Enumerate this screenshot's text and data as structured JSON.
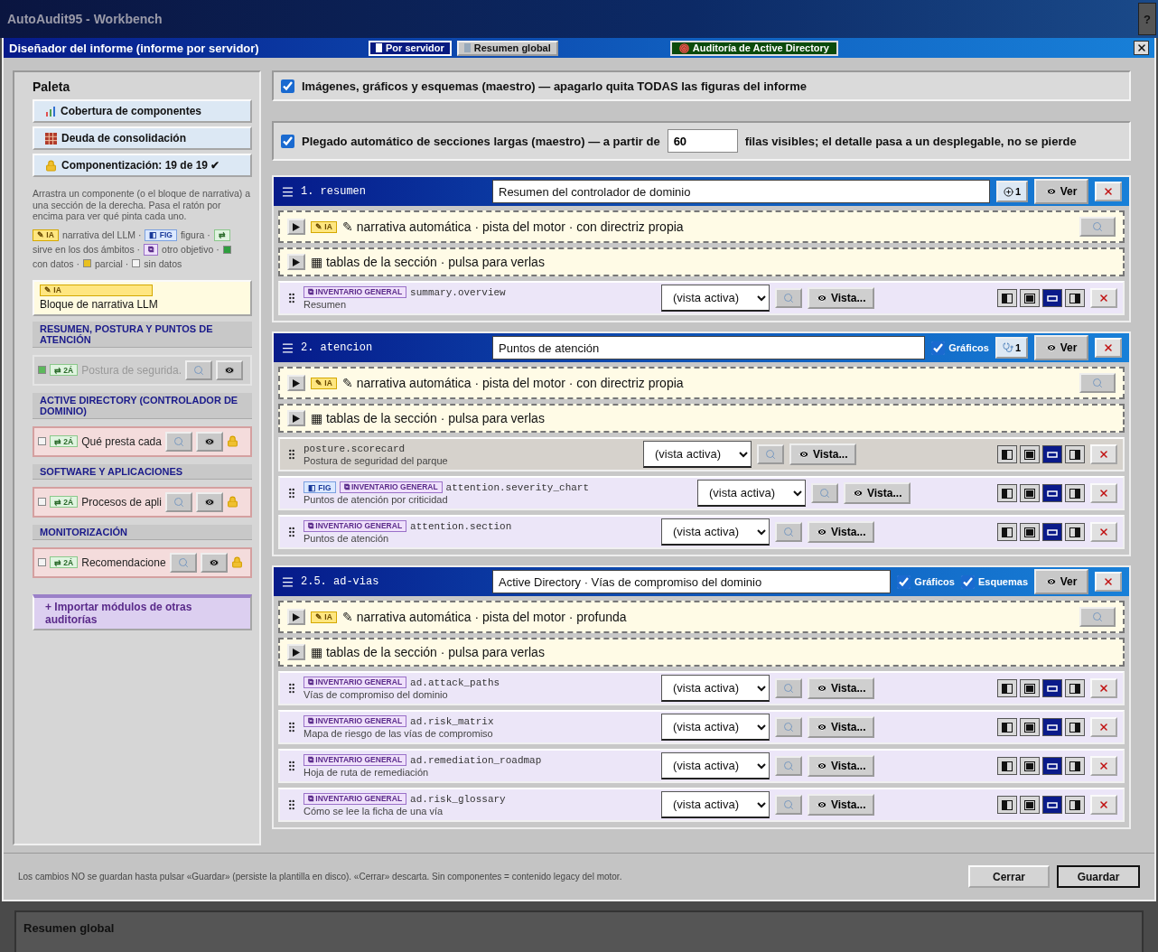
{
  "app": {
    "title": "AutoAudit95 - Workbench",
    "help": "?"
  },
  "dialog": {
    "title": "Diseñador del informe (informe por servidor)",
    "tabs": [
      {
        "label": "Por servidor",
        "selected": true
      },
      {
        "label": "Resumen global",
        "selected": false
      }
    ],
    "audit_button": "Auditoría de Active Directory"
  },
  "palette": {
    "title": "Paleta",
    "buttons": [
      {
        "kind": "chart",
        "label": "Cobertura de componentes"
      },
      {
        "kind": "grid",
        "label": "Deuda de consolidación"
      },
      {
        "kind": "lock",
        "label": "Componentización: 19 de 19 ✔"
      }
    ],
    "help": "Arrastra un componente (o el bloque de narrativa) a una sección de la derecha. Pasa el ratón por encima para ver qué pinta cada uno.",
    "legend": [
      {
        "kind": "ia",
        "text": "✎ IA"
      },
      {
        "kind": "text",
        "text": "narrativa del LLM ·"
      },
      {
        "kind": "fig",
        "text": "◧ FIG"
      },
      {
        "kind": "text",
        "text": "figura ·"
      },
      {
        "kind": "both",
        "text": "⇄"
      },
      {
        "kind": "text",
        "text": "sirve en los dos ámbitos ·"
      },
      {
        "kind": "other",
        "text": "⧉"
      },
      {
        "kind": "text",
        "text": "otro objetivo ·"
      },
      {
        "kind": "swatch",
        "color": "#2e9e3e"
      },
      {
        "kind": "text",
        "text": "con datos ·"
      },
      {
        "kind": "swatch",
        "color": "#e8c020"
      },
      {
        "kind": "text",
        "text": "parcial ·"
      },
      {
        "kind": "swatch",
        "color": "#f4f4f4"
      },
      {
        "kind": "text",
        "text": "sin datos"
      }
    ],
    "narrative_block": {
      "badge": "✎ IA",
      "label": "Bloque de narrativa LLM"
    },
    "groups": [
      {
        "title": "RESUMEN, POSTURA Y PUNTOS DE ATENCIÓN",
        "items": [
          {
            "label": "Postura de segurida.",
            "badge": "⇄ 2Á",
            "color": "#5cb85c",
            "disabled": true,
            "locked": false
          }
        ]
      },
      {
        "title": "ACTIVE DIRECTORY (CONTROLADOR DE DOMINIO)",
        "items": [
          {
            "label": "Qué presta cada",
            "badge": "⇄ 2Á",
            "color": "#f4f4f4",
            "disabled": false,
            "locked": true
          }
        ]
      },
      {
        "title": "SOFTWARE Y APLICACIONES",
        "items": [
          {
            "label": "Procesos de apli",
            "badge": "⇄ 2Á",
            "color": "#f4f4f4",
            "disabled": false,
            "locked": true
          }
        ]
      },
      {
        "title": "MONITORIZACIÓN",
        "items": [
          {
            "label": "Recomendacione",
            "badge": "⇄ 2Á",
            "color": "#f4f4f4",
            "disabled": false,
            "locked": true
          }
        ]
      }
    ],
    "import_button": "+ Importar módulos de otras auditorías"
  },
  "masters": [
    {
      "checked": true,
      "text": "Imágenes, gráficos y esquemas (maestro) — apagarlo quita TODAS las figuras del informe"
    },
    {
      "checked": true,
      "text": "Plegado automático de secciones largas (maestro) — a partir de",
      "value": "60",
      "text_after": "filas visibles; el detalle pasa a un desplegable, no se pierde"
    }
  ],
  "sections": [
    {
      "number": "1. resumen",
      "title": "Resumen del controlador de dominio",
      "counter": {
        "kind": "link",
        "text": "1"
      },
      "view": "Ver",
      "narrative": {
        "badge": "✎ IA",
        "text": "✎ narrativa automática · pista del motor · con directriz propia"
      },
      "tables": "▦ tablas de la sección · pulsa para verlas",
      "components": [
        {
          "kind": "inventory",
          "badges": [
            {
              "kind": "other",
              "text": "⧉ INVENTARIO GENERAL"
            }
          ],
          "key": "summary.overview",
          "desc": "Resumen",
          "select": "(vista activa)",
          "vista": "Vista...",
          "layouts": [
            {
              "kind": "left",
              "selected": false
            },
            {
              "kind": "full",
              "selected": false
            },
            {
              "kind": "wide",
              "selected": true
            },
            {
              "kind": "right",
              "selected": false
            }
          ]
        }
      ]
    },
    {
      "number": "2. atencion",
      "title": "Puntos de atención",
      "toggles": [
        {
          "label": "Gráficos",
          "checked": true
        }
      ],
      "counter": {
        "kind": "stethoscope",
        "text": "1"
      },
      "view": "Ver",
      "narrative": {
        "badge": "✎ IA",
        "text": "✎ narrativa automática · pista del motor · con directriz propia"
      },
      "tables": "▦ tablas de la sección · pulsa para verlas",
      "components": [
        {
          "kind": "native",
          "key": "posture.scorecard",
          "desc": "Postura de seguridad del parque",
          "select": "(vista activa)",
          "vista": "Vista...",
          "layouts": [
            {
              "kind": "left",
              "selected": false
            },
            {
              "kind": "full",
              "selected": false
            },
            {
              "kind": "wide",
              "selected": true
            },
            {
              "kind": "right",
              "selected": false
            }
          ]
        },
        {
          "kind": "inventory",
          "badges": [
            {
              "kind": "fig",
              "text": "◧ FIG"
            },
            {
              "kind": "other",
              "text": "⧉ INVENTARIO GENERAL"
            }
          ],
          "key": "attention.severity_chart",
          "desc": "Puntos de atención por criticidad",
          "select": "(vista activa)",
          "vista": "Vista...",
          "layouts": [
            {
              "kind": "left",
              "selected": false
            },
            {
              "kind": "full",
              "selected": false
            },
            {
              "kind": "wide",
              "selected": true
            },
            {
              "kind": "right",
              "selected": false
            }
          ]
        },
        {
          "kind": "inventory",
          "badges": [
            {
              "kind": "other",
              "text": "⧉ INVENTARIO GENERAL"
            }
          ],
          "key": "attention.section",
          "desc": "Puntos de atención",
          "select": "(vista activa)",
          "vista": "Vista...",
          "layouts": [
            {
              "kind": "left",
              "selected": false
            },
            {
              "kind": "full",
              "selected": false
            },
            {
              "kind": "wide",
              "selected": true
            },
            {
              "kind": "right",
              "selected": false
            }
          ]
        }
      ]
    },
    {
      "number": "2.5. ad-vias",
      "title": "Active Directory · Vías de compromiso del dominio",
      "toggles": [
        {
          "label": "Gráficos",
          "checked": true
        },
        {
          "label": "Esquemas",
          "checked": true
        }
      ],
      "view": "Ver",
      "narrative": {
        "badge": "✎ IA",
        "text": "✎ narrativa automática · pista del motor · profunda"
      },
      "tables": "▦ tablas de la sección · pulsa para verlas",
      "components": [
        {
          "kind": "inventory",
          "badges": [
            {
              "kind": "other",
              "text": "⧉ INVENTARIO GENERAL"
            }
          ],
          "key": "ad.attack_paths",
          "desc": "Vías de compromiso del dominio",
          "select": "(vista activa)",
          "vista": "Vista...",
          "layouts": [
            {
              "kind": "left",
              "selected": false
            },
            {
              "kind": "full",
              "selected": false
            },
            {
              "kind": "wide",
              "selected": true
            },
            {
              "kind": "right",
              "selected": false
            }
          ]
        },
        {
          "kind": "inventory",
          "badges": [
            {
              "kind": "other",
              "text": "⧉ INVENTARIO GENERAL"
            }
          ],
          "key": "ad.risk_matrix",
          "desc": "Mapa de riesgo de las vías de compromiso",
          "select": "(vista activa)",
          "vista": "Vista...",
          "layouts": [
            {
              "kind": "left",
              "selected": false
            },
            {
              "kind": "full",
              "selected": false
            },
            {
              "kind": "wide",
              "selected": true
            },
            {
              "kind": "right",
              "selected": false
            }
          ]
        },
        {
          "kind": "inventory",
          "badges": [
            {
              "kind": "other",
              "text": "⧉ INVENTARIO GENERAL"
            }
          ],
          "key": "ad.remediation_roadmap",
          "desc": "Hoja de ruta de remediación",
          "select": "(vista activa)",
          "vista": "Vista...",
          "layouts": [
            {
              "kind": "left",
              "selected": false
            },
            {
              "kind": "full",
              "selected": false
            },
            {
              "kind": "wide",
              "selected": true
            },
            {
              "kind": "right",
              "selected": false
            }
          ]
        },
        {
          "kind": "inventory",
          "badges": [
            {
              "kind": "other",
              "text": "⧉ INVENTARIO GENERAL"
            }
          ],
          "key": "ad.risk_glossary",
          "desc": "Cómo se lee la ficha de una vía",
          "select": "(vista activa)",
          "vista": "Vista...",
          "layouts": [
            {
              "kind": "left",
              "selected": false
            },
            {
              "kind": "full",
              "selected": false
            },
            {
              "kind": "wide",
              "selected": true
            },
            {
              "kind": "right",
              "selected": false
            }
          ]
        }
      ]
    }
  ],
  "footer": {
    "note": "Los cambios NO se guardan hasta pulsar «Guardar» (persiste la plantilla en disco). «Cerrar» descarta. Sin componentes = contenido legacy del motor.",
    "buttons": [
      "Cerrar",
      "Guardar"
    ]
  },
  "background_panel": {
    "title": "Resumen global"
  }
}
